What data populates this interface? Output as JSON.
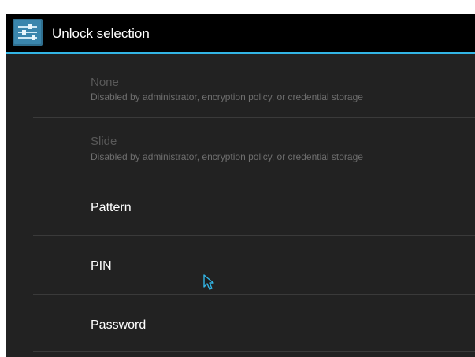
{
  "action_bar": {
    "title": "Unlock selection",
    "icon": "settings-sliders-icon",
    "accent_color": "#33b5e5"
  },
  "options": [
    {
      "label": "None",
      "subtitle": "Disabled by administrator, encryption policy, or credential storage",
      "enabled": false
    },
    {
      "label": "Slide",
      "subtitle": "Disabled by administrator, encryption policy, or credential storage",
      "enabled": false
    },
    {
      "label": "Pattern",
      "enabled": true
    },
    {
      "label": "PIN",
      "enabled": true
    },
    {
      "label": "Password",
      "enabled": true
    }
  ]
}
